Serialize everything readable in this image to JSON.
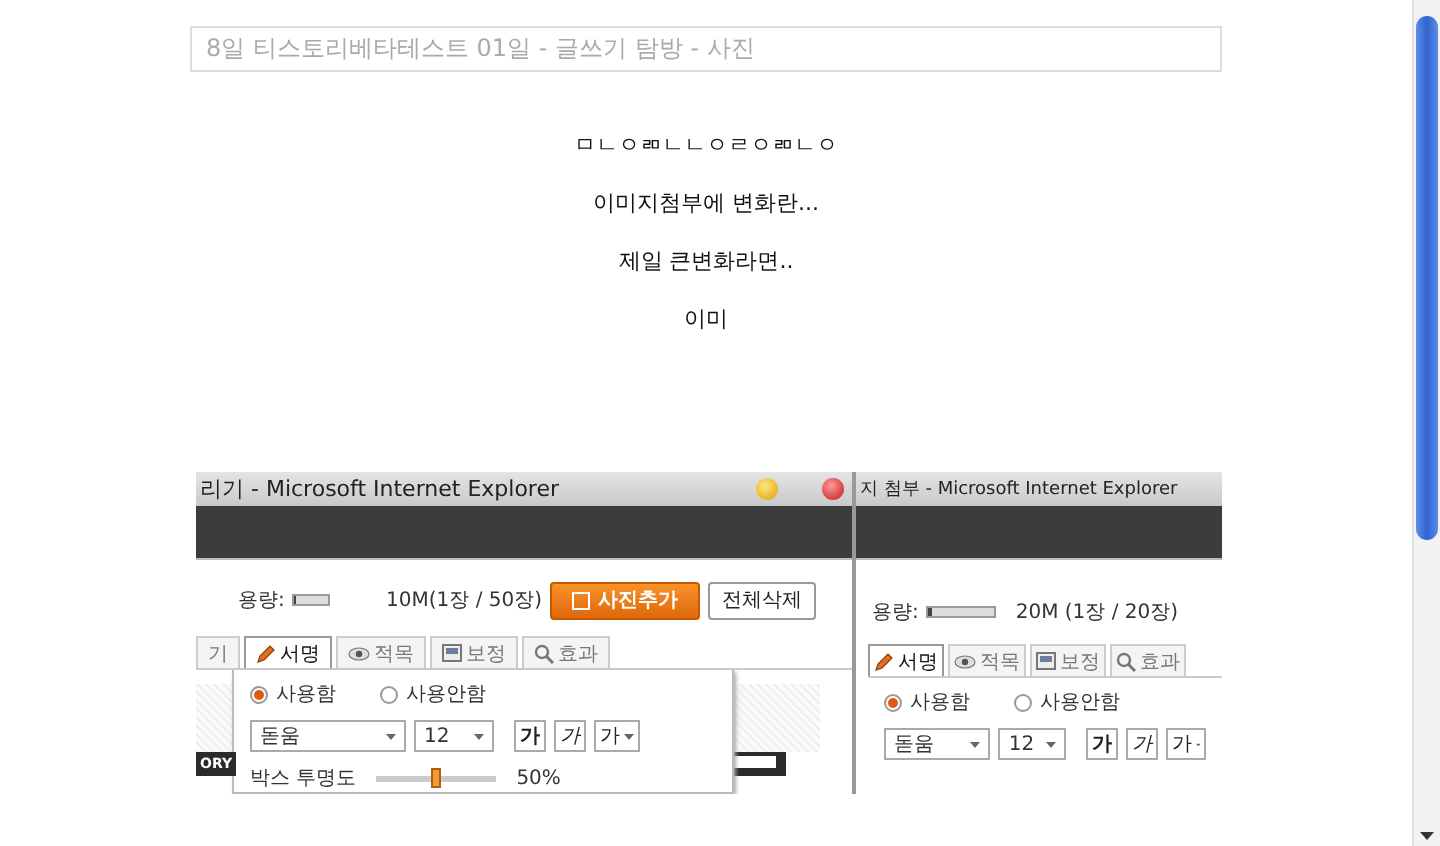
{
  "title_field": {
    "value": "8일 티스토리베타테스트 01일 - 글쓰기 탐방 - 사진"
  },
  "body_lines": [
    "ㅁㄴㅇㄻㄴㄴㅇㄹㅇㄻㄴㅇ",
    "이미지첨부에 변화란...",
    "제일 큰변화라면..",
    "이미"
  ],
  "embedded_screenshot": {
    "windows": [
      {
        "title": "리기 - Microsoft Internet Explorer",
        "capacity_label": "용량:",
        "capacity_bar": {
          "level": 0.03
        },
        "capacity_text": "10M(1장 / 50장)",
        "buttons": [
          {
            "label": "사진추가",
            "kind": "primary"
          },
          {
            "label": "전체삭제",
            "kind": "default"
          }
        ],
        "tabs": [
          {
            "label": "기",
            "selected": false,
            "kind": "plain"
          },
          {
            "label": "서명",
            "selected": true,
            "kind": "signature"
          },
          {
            "label": "적목",
            "selected": false,
            "kind": "redeye"
          },
          {
            "label": "보정",
            "selected": false,
            "kind": "correction"
          },
          {
            "label": "효과",
            "selected": false,
            "kind": "effect"
          }
        ],
        "radio_options": [
          {
            "label": "사용함",
            "selected": true
          },
          {
            "label": "사용안함",
            "selected": false
          }
        ],
        "font_select": "돋움",
        "size_select": "12",
        "style_buttons": [
          {
            "label": "가",
            "kind": "bold"
          },
          {
            "label": "가",
            "kind": "italic"
          },
          {
            "label": "가",
            "kind": "menu"
          }
        ],
        "opacity_label": "박스 투명도",
        "opacity_slider": {
          "level": 0.5
        },
        "opacity_text": "50%",
        "banner_text": "ORY"
      },
      {
        "title": "지 첨부 - Microsoft Internet Explorer",
        "capacity_label": "용량:",
        "capacity_bar": {
          "level": 0.05
        },
        "capacity_text": "20M (1장 / 20장)",
        "tabs": [
          {
            "label": "서명",
            "selected": true,
            "kind": "signature"
          },
          {
            "label": "적목",
            "selected": false,
            "kind": "redeye"
          },
          {
            "label": "보정",
            "selected": false,
            "kind": "correction"
          },
          {
            "label": "효과",
            "selected": false,
            "kind": "effect"
          }
        ],
        "radio_options": [
          {
            "label": "사용함",
            "selected": true
          },
          {
            "label": "사용안함",
            "selected": false
          }
        ],
        "font_select": "돋움",
        "size_select": "12",
        "style_buttons": [
          {
            "label": "가",
            "kind": "bold"
          },
          {
            "label": "가",
            "kind": "italic"
          },
          {
            "label": "가",
            "kind": "menu"
          }
        ]
      }
    ]
  }
}
